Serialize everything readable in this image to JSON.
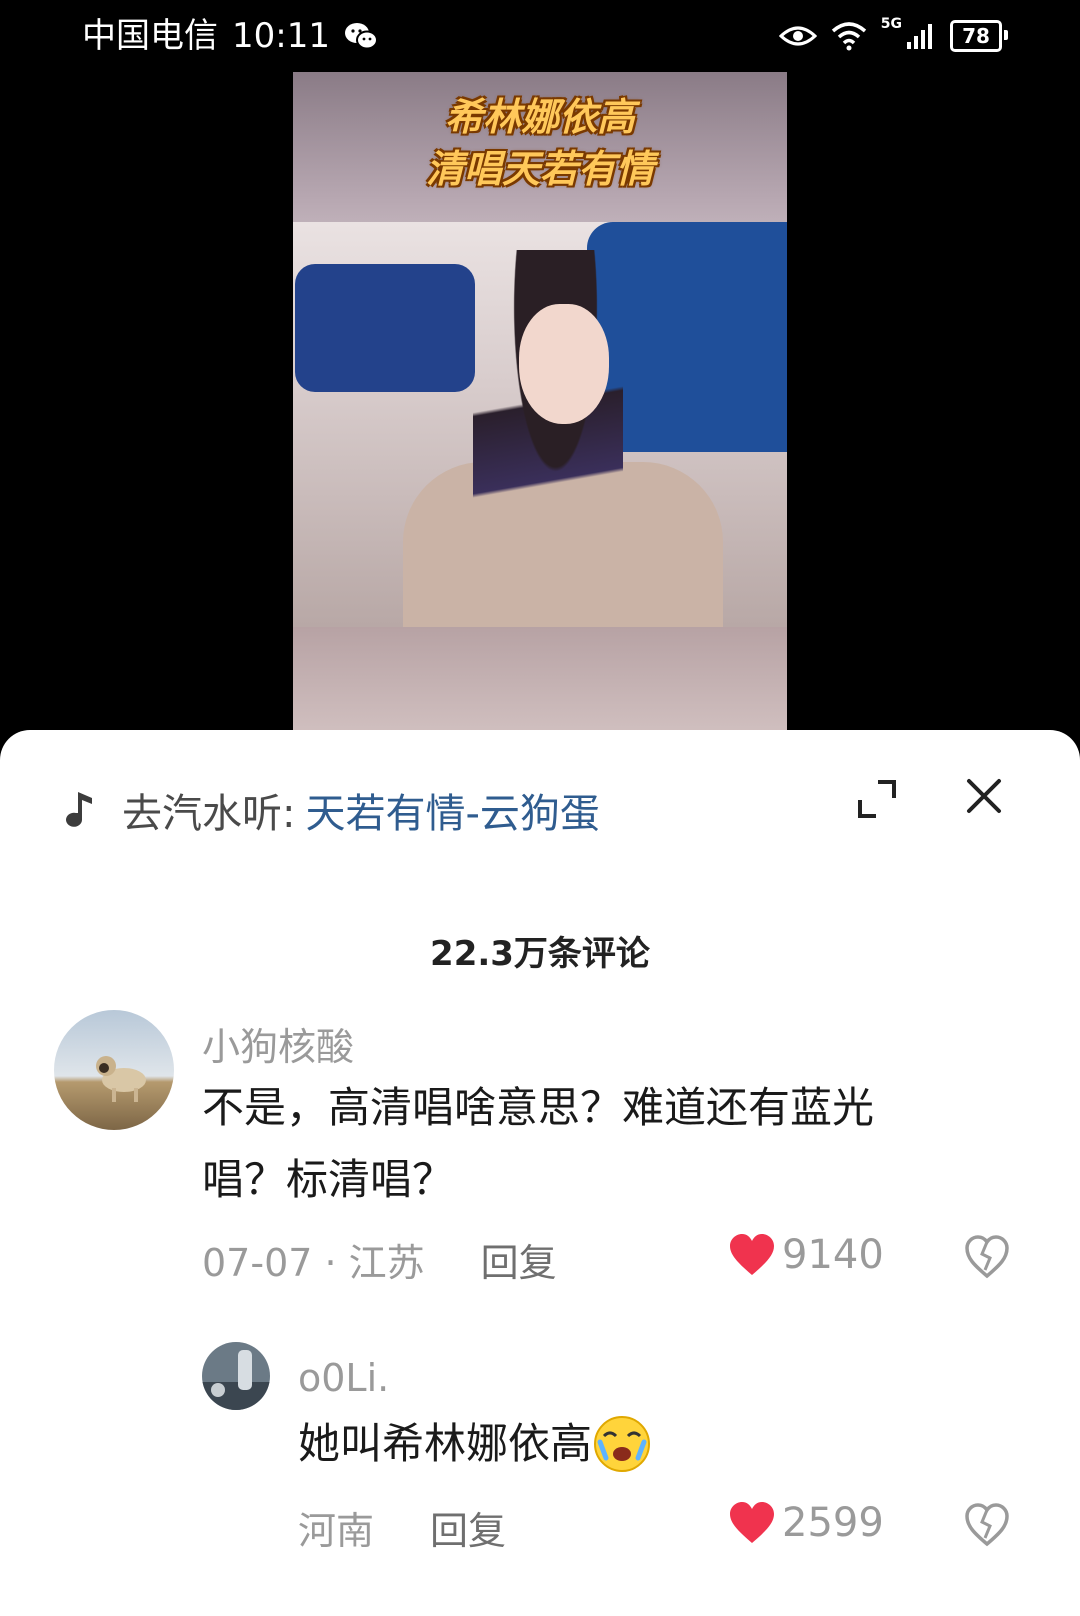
{
  "status_bar": {
    "carrier": "中国电信",
    "time": "10:11",
    "battery": "78",
    "network": "5G"
  },
  "video": {
    "caption_line1": "希林娜依高",
    "caption_line2": "清唱天若有情"
  },
  "music": {
    "label": "去汽水听:",
    "song": "天若有情-云狗蛋"
  },
  "comments_header": "22.3万条评论",
  "comments": [
    {
      "username": "小狗核酸",
      "text_line1": "不是，高清唱啥意思？难道还有蓝光",
      "text_line2": "唱？标清唱？",
      "date_location": "07-07 · 江苏",
      "reply_label": "回复",
      "likes": "9140"
    },
    {
      "username": "o0Li.",
      "text": "她叫希林娜依高",
      "location": "河南",
      "reply_label": "回复",
      "likes": "2599"
    }
  ],
  "colors": {
    "like": "#f0334e",
    "link": "#2f5c8f",
    "muted": "#9a9a9a"
  }
}
